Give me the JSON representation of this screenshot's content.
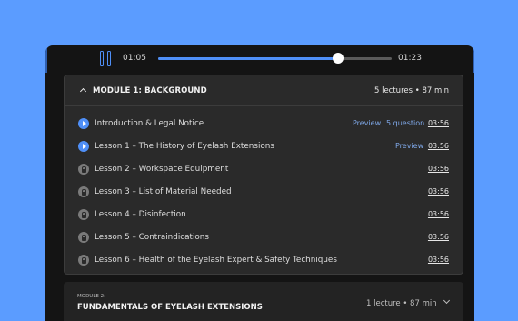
{
  "player": {
    "current_time": "01:05",
    "duration": "01:23",
    "progress": 0.77,
    "accent_color": "#4f8ff7"
  },
  "modules": [
    {
      "title": "MODULE 1: BACKGROUND",
      "meta": "5 lectures • 87 min",
      "expanded": true,
      "lectures": [
        {
          "title": "Introduction & Legal Notice",
          "icon": "play-icon",
          "preview": "Preview",
          "question": "5 question",
          "duration": "03:56"
        },
        {
          "title": "Lesson 1 – The History of Eyelash Extensions",
          "icon": "play-icon",
          "preview": "Preview",
          "duration": "03:56"
        },
        {
          "title": "Lesson 2 – Workspace Equipment",
          "icon": "lock-icon",
          "duration": "03:56"
        },
        {
          "title": "Lesson 3 – List of Material Needed",
          "icon": "lock-icon",
          "duration": "03:56"
        },
        {
          "title": "Lesson 4 – Disinfection",
          "icon": "lock-icon",
          "duration": "03:56"
        },
        {
          "title": "Lesson 5 – Contraindications",
          "icon": "lock-icon",
          "duration": "03:56"
        },
        {
          "title": "Lesson 6 – Health of the Eyelash Expert & Safety Techniques",
          "icon": "lock-icon",
          "duration": "03:56"
        }
      ]
    },
    {
      "kicker": "MODULE 2:",
      "title": "FUNDAMENTALS OF EYELASH EXTENSIONS",
      "meta": "1 lecture • 87 min",
      "expanded": false
    }
  ]
}
